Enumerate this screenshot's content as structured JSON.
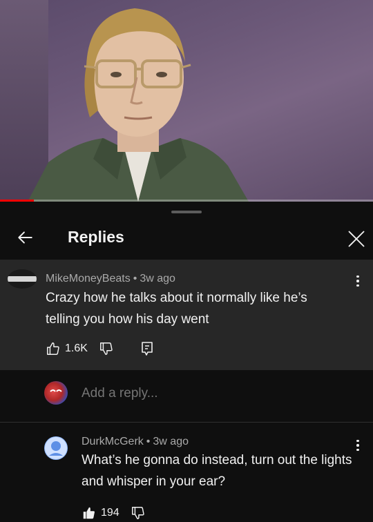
{
  "video": {
    "progress_fraction": 0.09,
    "progress_color": "#ff0000"
  },
  "replies_panel": {
    "title": "Replies",
    "back_icon": "arrow-left-icon",
    "close_icon": "close-icon"
  },
  "parent_comment": {
    "author": "MikeMoneyBeats",
    "separator": "•",
    "time": "3w ago",
    "text": "Crazy how he talks about it normally like he’s telling you how his day went",
    "likes": "1.6K",
    "icons": [
      "thumbs-up-icon",
      "thumbs-down-icon",
      "reply-comment-icon",
      "more-vert-icon"
    ]
  },
  "add_reply": {
    "placeholder": "Add a reply..."
  },
  "replies": [
    {
      "author": "DurkMcGerk",
      "separator": "•",
      "time": "3w ago",
      "text": "What’s he gonna do instead, turn out the lights and whisper in your ear?",
      "likes": "194",
      "liked": true,
      "icons": [
        "thumbs-up-filled-icon",
        "thumbs-down-icon",
        "more-vert-icon"
      ]
    }
  ],
  "colors": {
    "background": "#0f0f0f",
    "highlight_row": "#272727",
    "secondary_text": "#aaaaaa",
    "primary_text": "#f1f1f1"
  }
}
